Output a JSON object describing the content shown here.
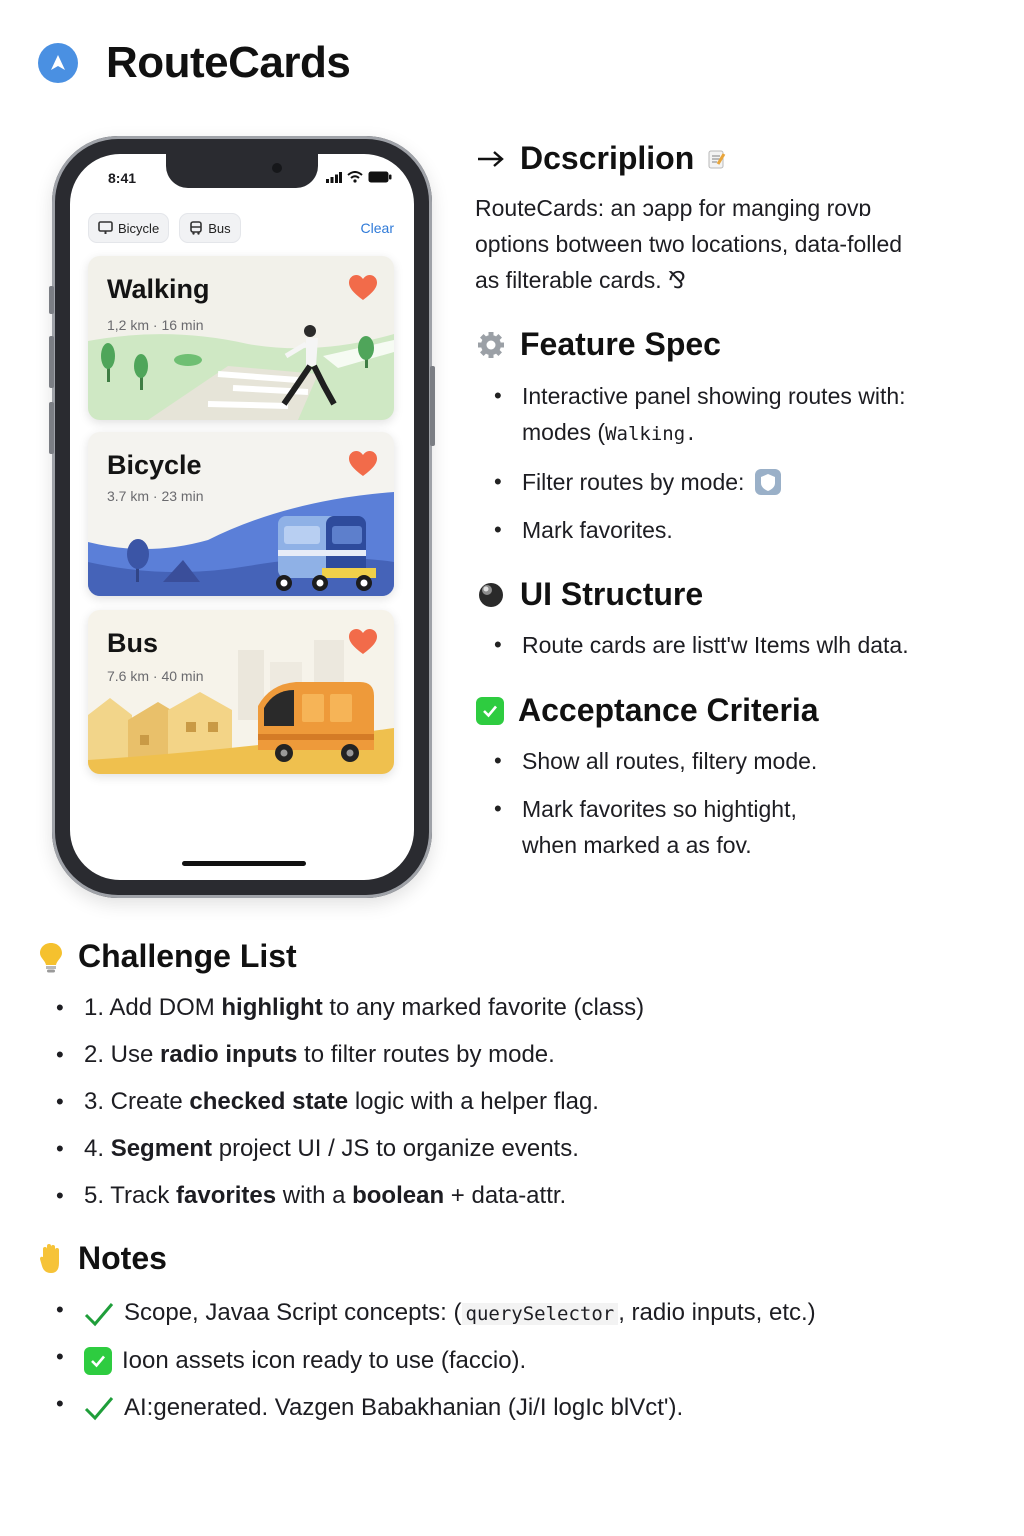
{
  "app": {
    "title": "RouteCards",
    "logo_icon": "navigation-logo-icon"
  },
  "phone": {
    "status": {
      "time": "8:41"
    },
    "filters": [
      {
        "label": "Bicycle",
        "icon": "monitor-icon"
      },
      {
        "label": "Bus",
        "icon": "bus-icon"
      }
    ],
    "clear_label": "Clear",
    "cards": [
      {
        "name": "Walking",
        "meta": "1,2 km · 16 min",
        "favorite": true
      },
      {
        "name": "Bicycle",
        "meta": "3.7 km · 23 min",
        "favorite": true
      },
      {
        "name": "Bus",
        "meta": "7.6 km · 40 min",
        "favorite": true
      }
    ],
    "colors": {
      "accent": "#2f7ad8",
      "heart": "#f26b4a",
      "walking_bg": "#f2f1ea",
      "bicycle_bg": "#f4f3ef",
      "bus_bg": "#f6f3ea"
    }
  },
  "description": {
    "title": "Dcscriplion",
    "text_line1": "RouteCards: an ɔapp for manging rovɒ",
    "text_line2": "options botween two locations, data-folled",
    "text_line3": "as filterable cards. ⅋"
  },
  "feature_spec": {
    "title": "Feature Spec",
    "item1_line1": "Interactive panel showing routes with:",
    "item1_line2a": "modes (",
    "item1_line2b": "Walking.",
    "item2": "Filter routes by mode:",
    "item3": "Mark favorites."
  },
  "ui_structure": {
    "title": "UI Structure",
    "item1": "Route cards are listt'w Items wlh data."
  },
  "acceptance": {
    "title": "Acceptance Criteria",
    "item1": "Show all routes, filtery mode.",
    "item2_line1": "Mark favorites so hightight,",
    "item2_line2": "when marked a as fov."
  },
  "challenges": {
    "title": "Challenge List",
    "items": [
      {
        "pre": "1. Add DOM ",
        "bold": "highlight",
        "post": " to any marked favorite (class)"
      },
      {
        "pre": "2. Use ",
        "bold": "radio inputs",
        "post": " to filter routes by mode."
      },
      {
        "pre": "3. Create ",
        "bold": "checked state",
        "post": " logic with a helper flag."
      },
      {
        "pre": "4. ",
        "bold": "Segment",
        "post": " project UI / JS to organize events."
      },
      {
        "pre": "5. Track ",
        "bold": "favorites",
        "post": " with a "
      },
      {
        "pre": "",
        "bold": "boolean",
        "post": " + data-attr."
      }
    ]
  },
  "notes": {
    "title": "Notes",
    "item1_pre": "Scope, Javaa Script concepts:  (",
    "item1_code": "querySelector",
    "item1_post": ", radio inputs, etc.)",
    "item2": "Ioon assets icon ready to use (faccio).",
    "item3_pre": "AI:generated. Vazgen Babakhanian",
    "item3_post": "(Ji/I logIc blVct')."
  }
}
